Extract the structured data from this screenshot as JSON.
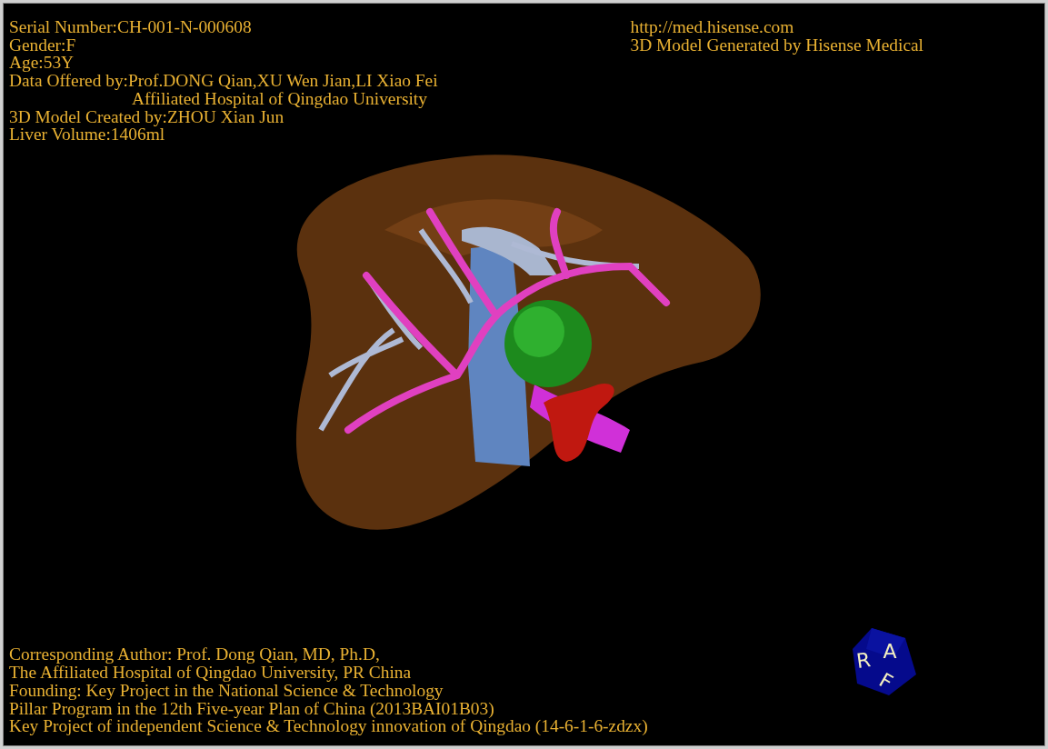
{
  "info_left": [
    {
      "text": "Serial Number:CH-001-N-000608",
      "kind": "line"
    },
    {
      "text": "Gender:F",
      "kind": "line"
    },
    {
      "text": "Age:53Y",
      "kind": "line"
    },
    {
      "text": "Data Offered by:Prof.DONG Qian,XU Wen Jian,LI Xiao Fei",
      "kind": "line"
    },
    {
      "text": "Affiliated Hospital of Qingdao University",
      "kind": "continuation"
    },
    {
      "text": "3D Model Created by:ZHOU Xian Jun",
      "kind": "line"
    },
    {
      "text": "Liver Volume:1406ml",
      "kind": "line"
    }
  ],
  "info_right": [
    {
      "text": "http://med.hisense.com"
    },
    {
      "text": "3D Model Generated by Hisense Medical"
    }
  ],
  "credits": [
    {
      "text": "Corresponding Author: Prof. Dong Qian, MD, Ph.D,"
    },
    {
      "text": "The Affiliated Hospital of Qingdao University, PR China"
    },
    {
      "text": "Founding: Key Project in the National Science & Technology"
    },
    {
      "text": "Pillar Program in the 12th Five-year Plan of China (2013BAI01B03)"
    },
    {
      "text": "Key Project of independent Science & Technology innovation of Qingdao (14-6-1-6-zdzx)"
    }
  ],
  "orientation_cube": {
    "faces": [
      "R",
      "A",
      "F"
    ]
  }
}
